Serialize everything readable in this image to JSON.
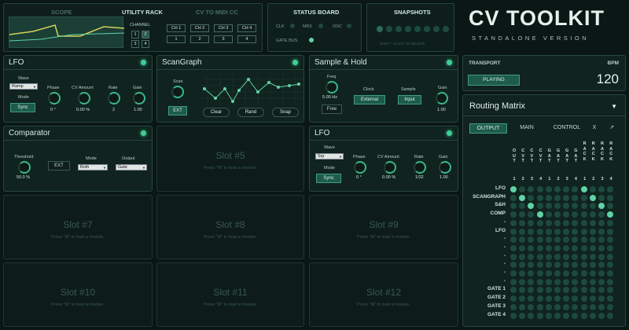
{
  "top": {
    "scope_label": "SCOPE",
    "utility_rack": "UTILITY RACK",
    "cv_to_midi": "CV TO MIDI CC",
    "channel_label": "CHANNEL",
    "channels": [
      "1",
      "2",
      "3",
      "4"
    ],
    "ch_buttons": [
      "CH 1",
      "CH 2",
      "CH 3",
      "CH 4"
    ],
    "ch_values": [
      "1",
      "2",
      "3",
      "4"
    ],
    "status_board": "STATUS BOARD",
    "status_items": [
      "CLK",
      "MIDI",
      "OSC",
      "GATE BUS"
    ],
    "snapshots": "SNAPSHOTS",
    "snapshots_hint": "SHIFT + CLICK TO DELETE"
  },
  "brand": {
    "title": "CV TOOLKIT",
    "subtitle": "STANDALONE VERSION"
  },
  "transport": {
    "label": "TRANSPORT",
    "bpm_label": "BPM",
    "state": "PLAYING",
    "bpm": "120"
  },
  "routing": {
    "title": "Routing Matrix",
    "tabs": [
      "OUTPUT",
      "MAIN",
      "CONTROL",
      "X"
    ],
    "col_headers": [
      "O\nU\nT",
      "C\nV\nT",
      "C\nV\nT",
      "C\nV\nT",
      "G\nA\nT",
      "G\nA\nT",
      "G\nA\nT",
      "G\nA\nT",
      "R\nA\nC\nK",
      "R\nA\nC\nK",
      "R\nA\nC\nK",
      "R\nA\nC\nK"
    ],
    "col_numbers": [
      "1",
      "2",
      "3",
      "4",
      "1",
      "2",
      "3",
      "4",
      "1",
      "2",
      "3",
      "4"
    ],
    "rows": [
      "LFO",
      "SCANGRAPH",
      "S&H",
      "COMP",
      "-",
      "LFO",
      "-",
      "-",
      "-",
      "-",
      "-",
      "-",
      "GATE 1",
      "GATE 2",
      "GATE 3",
      "GATE 4"
    ],
    "active": [
      [
        0,
        0
      ],
      [
        0,
        8
      ],
      [
        1,
        1
      ],
      [
        1,
        9
      ],
      [
        2,
        2
      ],
      [
        2,
        10
      ],
      [
        3,
        3
      ],
      [
        3,
        11
      ]
    ]
  },
  "modules": {
    "lfo1": {
      "title": "LFO",
      "wave_label": "Wave",
      "wave": "Ramp",
      "mode_label": "Mode",
      "mode": "Sync",
      "knobs": [
        {
          "label": "Phase",
          "value": "0 °"
        },
        {
          "label": "CV Amount",
          "value": "0.00 %"
        },
        {
          "label": "Rate",
          "value": "2"
        },
        {
          "label": "Gain",
          "value": "1.00"
        }
      ]
    },
    "scangraph": {
      "title": "ScanGraph",
      "scan_label": "Scan",
      "ext": "EXT",
      "buttons": [
        "Clear",
        "Rand",
        "Snap"
      ]
    },
    "sh": {
      "title": "Sample & Hold",
      "freq_label": "Freq",
      "freq_value": "5.00 Hz",
      "free": "Free",
      "clock_label": "Clock",
      "clock": "External",
      "sample_label": "Sample",
      "sample": "Input",
      "gain_label": "Gain",
      "gain_value": "1.00"
    },
    "comparator": {
      "title": "Comparator",
      "threshold_label": "Threshold",
      "threshold_value": "50.0 %",
      "ext": "EXT",
      "mode_label": "Mode",
      "mode": "Both",
      "output_label": "Output",
      "output": "Gate"
    },
    "lfo2": {
      "title": "LFO",
      "wave_label": "Wave",
      "wave": "Sqr",
      "mode_label": "Mode",
      "mode": "Sync",
      "knobs": [
        {
          "label": "Phase",
          "value": "0 °"
        },
        {
          "label": "CV Amount",
          "value": "0.00 %"
        },
        {
          "label": "Rate",
          "value": "1/32"
        },
        {
          "label": "Gain",
          "value": "1.00"
        }
      ]
    }
  },
  "slots": [
    {
      "title": "Slot #5",
      "hint": "Press \"M\" to load a module."
    },
    {
      "title": "Slot #7",
      "hint": "Press \"M\" to load a module."
    },
    {
      "title": "Slot #8",
      "hint": "Press \"M\" to load a module."
    },
    {
      "title": "Slot #9",
      "hint": "Press \"M\" to load a module."
    },
    {
      "title": "Slot #10",
      "hint": "Press \"M\" to load a module."
    },
    {
      "title": "Slot #11",
      "hint": "Press \"M\" to load a module."
    },
    {
      "title": "Slot #12",
      "hint": "Press \"M\" to load a module."
    }
  ]
}
